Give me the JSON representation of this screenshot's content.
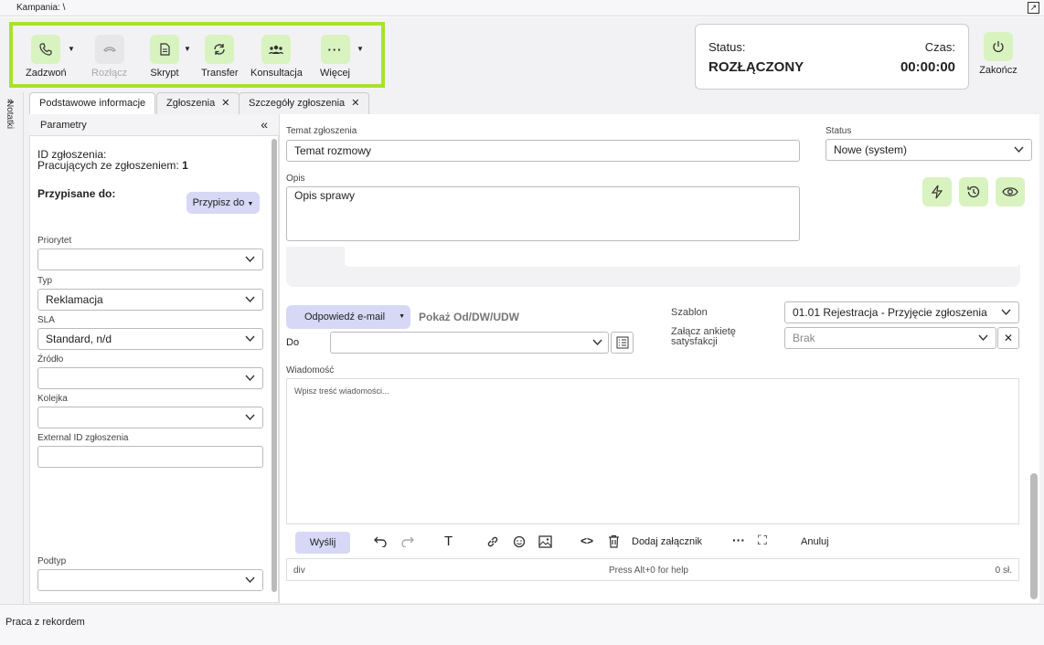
{
  "campaign": "Kampania: \\",
  "toolbar": {
    "call": "Zadzwoń",
    "disconnect": "Rozłącz",
    "script": "Skrypt",
    "transfer": "Transfer",
    "consult": "Konsultacja",
    "more": "Więcej"
  },
  "status_card": {
    "status_label": "Status:",
    "status_value": "ROZŁĄCZONY",
    "time_label": "Czas:",
    "time_value": "00:00:00"
  },
  "finish": "Zakończ",
  "notes": "Notatki",
  "tabs": [
    "Podstawowe informacje",
    "Zgłoszenia",
    "Szczegóły zgłoszenia"
  ],
  "left": {
    "header": "Parametry",
    "id_label": "ID zgłoszenia:",
    "working_label": "Pracujących ze zgłoszeniem:",
    "working_count": "1",
    "assigned": "Przypisane do:",
    "assign_btn": "Przypisz do",
    "priority": "Priorytet",
    "priority_value": "",
    "type": "Typ",
    "type_value": "Reklamacja",
    "sla": "SLA",
    "sla_value": "Standard, n/d",
    "source": "Źródło",
    "source_value": "",
    "queue": "Kolejka",
    "queue_value": "",
    "external": "External ID zgłoszenia",
    "external_value": "",
    "subtype": "Podtyp",
    "subtype_value": ""
  },
  "right": {
    "subject_label": "Temat zgłoszenia",
    "subject_value": "Temat rozmowy",
    "status_label": "Status",
    "status_value": "Nowe (system)",
    "desc_label": "Opis",
    "desc_value": "Opis sprawy",
    "reply_btn": "Odpowiedź e-mail",
    "show_link": "Pokaż Od/DW/UDW",
    "to_label": "Do",
    "to_value": "",
    "template_label": "Szablon",
    "template_value": "01.01 Rejestracja - Przyjęcie zgłoszenia",
    "survey_label": "Załącz ankietę satysfakcji",
    "survey_value": "Brak",
    "message_label": "Wiadomość",
    "message_placeholder": "Wpisz treść wiadomości...",
    "send": "Wyślij",
    "attach": "Dodaj załącznik",
    "cancel": "Anuluj",
    "path": "div",
    "help": "Press Alt+0 for help",
    "count": "0 sł."
  },
  "footer": "Praca z rekordem"
}
